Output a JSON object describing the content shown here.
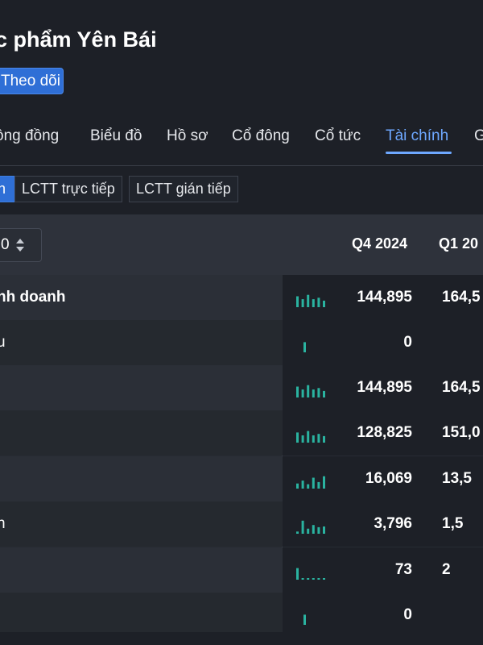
{
  "header": {
    "title": "c phẩm Yên Bái",
    "follow_label": "Theo dõi"
  },
  "tabs": [
    {
      "label": "ộng đồng",
      "active": false
    },
    {
      "label": "Biểu đồ",
      "active": false
    },
    {
      "label": "Hồ sơ",
      "active": false
    },
    {
      "label": "Cổ đông",
      "active": false
    },
    {
      "label": "Cổ tức",
      "active": false
    },
    {
      "label": "Tài chính",
      "active": true
    },
    {
      "label": "G",
      "active": false
    }
  ],
  "subtabs": [
    {
      "label": "h",
      "active": true
    },
    {
      "label": "LCTT trực tiếp",
      "active": false
    },
    {
      "label": "LCTT gián tiếp",
      "active": false
    }
  ],
  "table": {
    "period_select_value": "0",
    "columns": [
      "Q4 2024",
      "Q1 20"
    ],
    "rows": [
      {
        "label": "nh doanh",
        "bold": true,
        "values": [
          "144,895",
          "164,5"
        ],
        "spark": [
          0.75,
          0.55,
          0.85,
          0.55,
          0.65,
          0.45
        ],
        "accent": "#2ab3a0"
      },
      {
        "label": "u",
        "bold": false,
        "values": [
          "0",
          ""
        ],
        "spark": [
          0.7
        ],
        "accent": "#2ab3a0"
      },
      {
        "label": "",
        "bold": false,
        "values": [
          "144,895",
          "164,5"
        ],
        "spark": [
          0.75,
          0.55,
          0.85,
          0.55,
          0.65,
          0.45
        ],
        "accent": "#2ab3a0"
      },
      {
        "label": "",
        "bold": false,
        "values": [
          "128,825",
          "151,0"
        ],
        "spark": [
          0.7,
          0.5,
          0.8,
          0.5,
          0.6,
          0.45
        ],
        "accent": "#2ab3a0"
      },
      {
        "label": "",
        "bold": false,
        "values": [
          "16,069",
          "13,5"
        ],
        "spark": [
          0.35,
          0.55,
          0.3,
          0.75,
          0.45,
          0.85
        ],
        "accent": "#2ab3a0"
      },
      {
        "label": "n",
        "bold": false,
        "values": [
          "3,796",
          "1,5"
        ],
        "spark": [
          0.15,
          0.9,
          0.35,
          0.6,
          0.45,
          0.5
        ],
        "accent": "#2ab3a0"
      },
      {
        "label": "",
        "bold": false,
        "values": [
          "73",
          "2"
        ],
        "spark": [
          0.8,
          0.05,
          0.05,
          0.1,
          0.05,
          0.05
        ],
        "accent": "#2ab3a0"
      },
      {
        "label": "",
        "bold": false,
        "values": [
          "0",
          ""
        ],
        "spark": [
          0.7
        ],
        "accent": "#2ab3a0"
      }
    ]
  }
}
